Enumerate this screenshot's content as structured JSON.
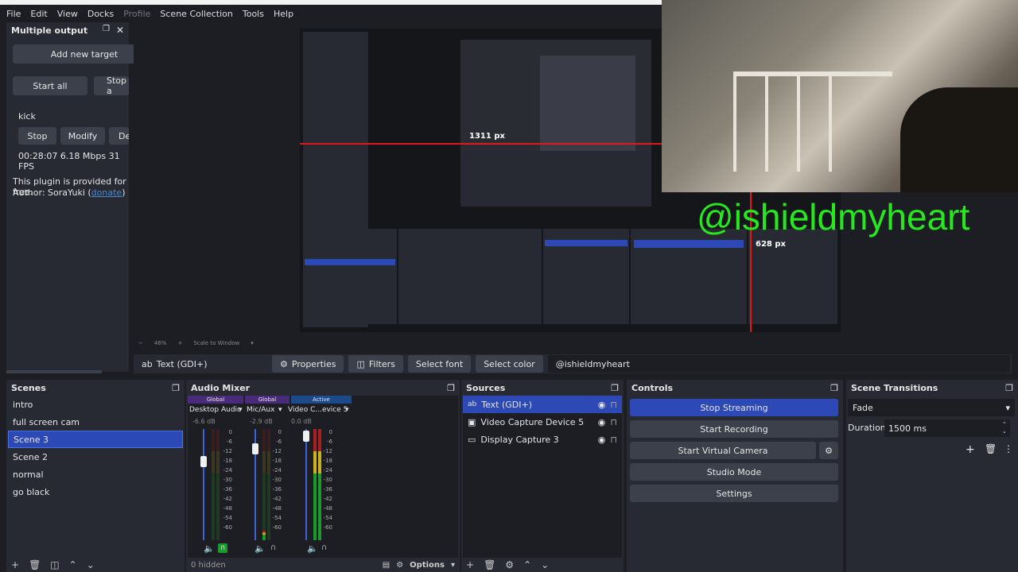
{
  "menu": [
    "File",
    "Edit",
    "View",
    "Docks",
    "Profile",
    "Scene Collection",
    "Tools",
    "Help"
  ],
  "multi_output": {
    "title": "Multiple output",
    "add_target": "Add new target",
    "start_all": "Start all",
    "stop_all": "Stop a",
    "target_name": "kick",
    "stop": "Stop",
    "modify": "Modify",
    "delete": "De",
    "stats": "00:28:07  6.18 Mbps  31 FPS",
    "free_text": "This plugin is provided for free.",
    "author_prefix": "Author: SoraYuki (",
    "donate": "donate",
    "author_suffix": ")"
  },
  "preview": {
    "handle_text": "@ishieldmyheart",
    "measure_1": "1311 px",
    "measure_2": "628 px",
    "zoom_minus": "−",
    "zoom": "46%",
    "zoom_plus": "+",
    "scale_mode": "Scale to Window"
  },
  "source_toolbar": {
    "source_name": "Text (GDI+)",
    "properties": "Properties",
    "filters": "Filters",
    "select_font": "Select font",
    "select_color": "Select color",
    "text_value": "@ishieldmyheart"
  },
  "scenes": {
    "title": "Scenes",
    "items": [
      "intro",
      "full screen cam",
      "Scene 3",
      "Scene 2",
      "normal",
      "go black"
    ],
    "selected": "Scene 3"
  },
  "audio": {
    "title": "Audio Mixer",
    "channels": [
      {
        "tag": "Global",
        "name": "Desktop Audio",
        "db": "-6.6 dB"
      },
      {
        "tag": "Global",
        "name": "Mic/Aux",
        "db": "-2.9 dB"
      },
      {
        "tag": "Active",
        "name": "Video C...evice 5",
        "db": "0.0 dB"
      }
    ],
    "scale": [
      "0",
      "-6",
      "-12",
      "-18",
      "-24",
      "-30",
      "-36",
      "-42",
      "-48",
      "-54",
      "-60"
    ],
    "hidden": "0 hidden",
    "options": "Options"
  },
  "sources": {
    "title": "Sources",
    "items": [
      "Text (GDI+)",
      "Video Capture Device 5",
      "Display Capture 3"
    ]
  },
  "controls": {
    "title": "Controls",
    "stop_streaming": "Stop Streaming",
    "start_recording": "Start Recording",
    "start_virtual_camera": "Start Virtual Camera",
    "studio_mode": "Studio Mode",
    "settings": "Settings"
  },
  "transitions": {
    "title": "Scene Transitions",
    "selected": "Fade",
    "duration_label": "Duration",
    "duration_value": "1500 ms"
  },
  "colors": {
    "accent": "#2c49b5",
    "handle_green": "#27e81f",
    "measure_red": "#e01818"
  }
}
